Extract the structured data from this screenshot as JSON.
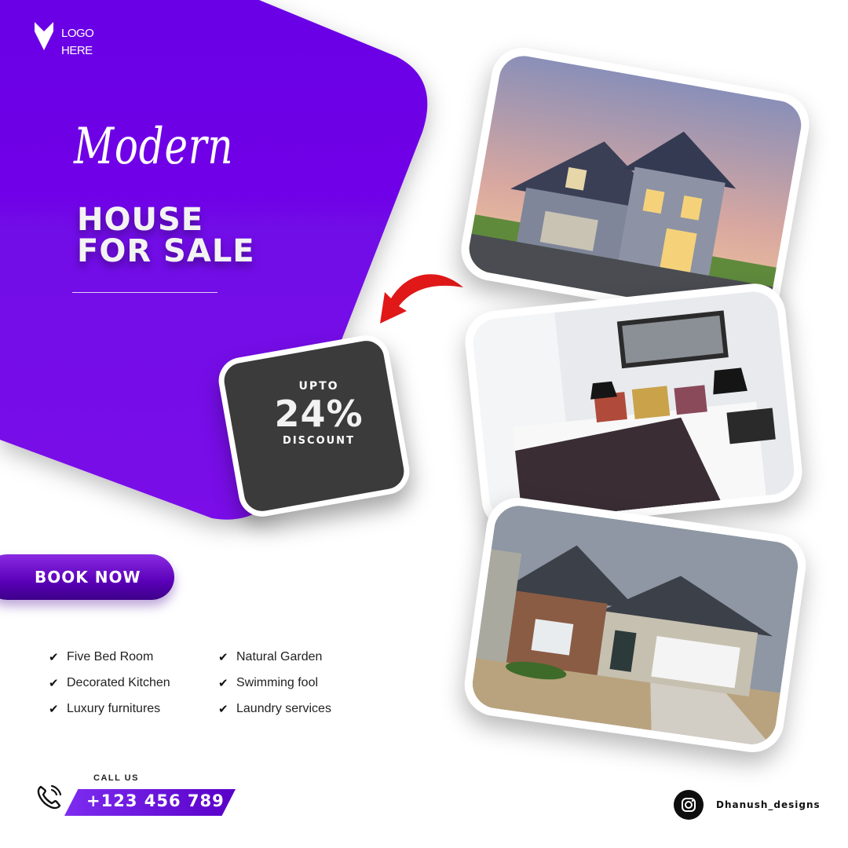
{
  "logo": {
    "line1": "LOGO",
    "line2": "HERE"
  },
  "title": {
    "script": "Modern",
    "line1": "HOUSE",
    "line2": "FOR SALE"
  },
  "discount": {
    "upto": "UPTO",
    "value": "24%",
    "label": "DISCOUNT"
  },
  "cta": {
    "book_label": "BOOK NOW"
  },
  "features": {
    "left": [
      "Five Bed Room",
      "Decorated Kitchen",
      "Luxury furnitures"
    ],
    "right": [
      "Natural Garden",
      "Swimming fool",
      "Laundry services"
    ]
  },
  "contact": {
    "call_label": "CALL US",
    "phone": "+123 456 789"
  },
  "social": {
    "handle": "Dhanush_designs"
  },
  "colors": {
    "brand_purple": "#6a00e6",
    "dark_card": "#3b3b3b",
    "arrow_red": "#e01818"
  }
}
